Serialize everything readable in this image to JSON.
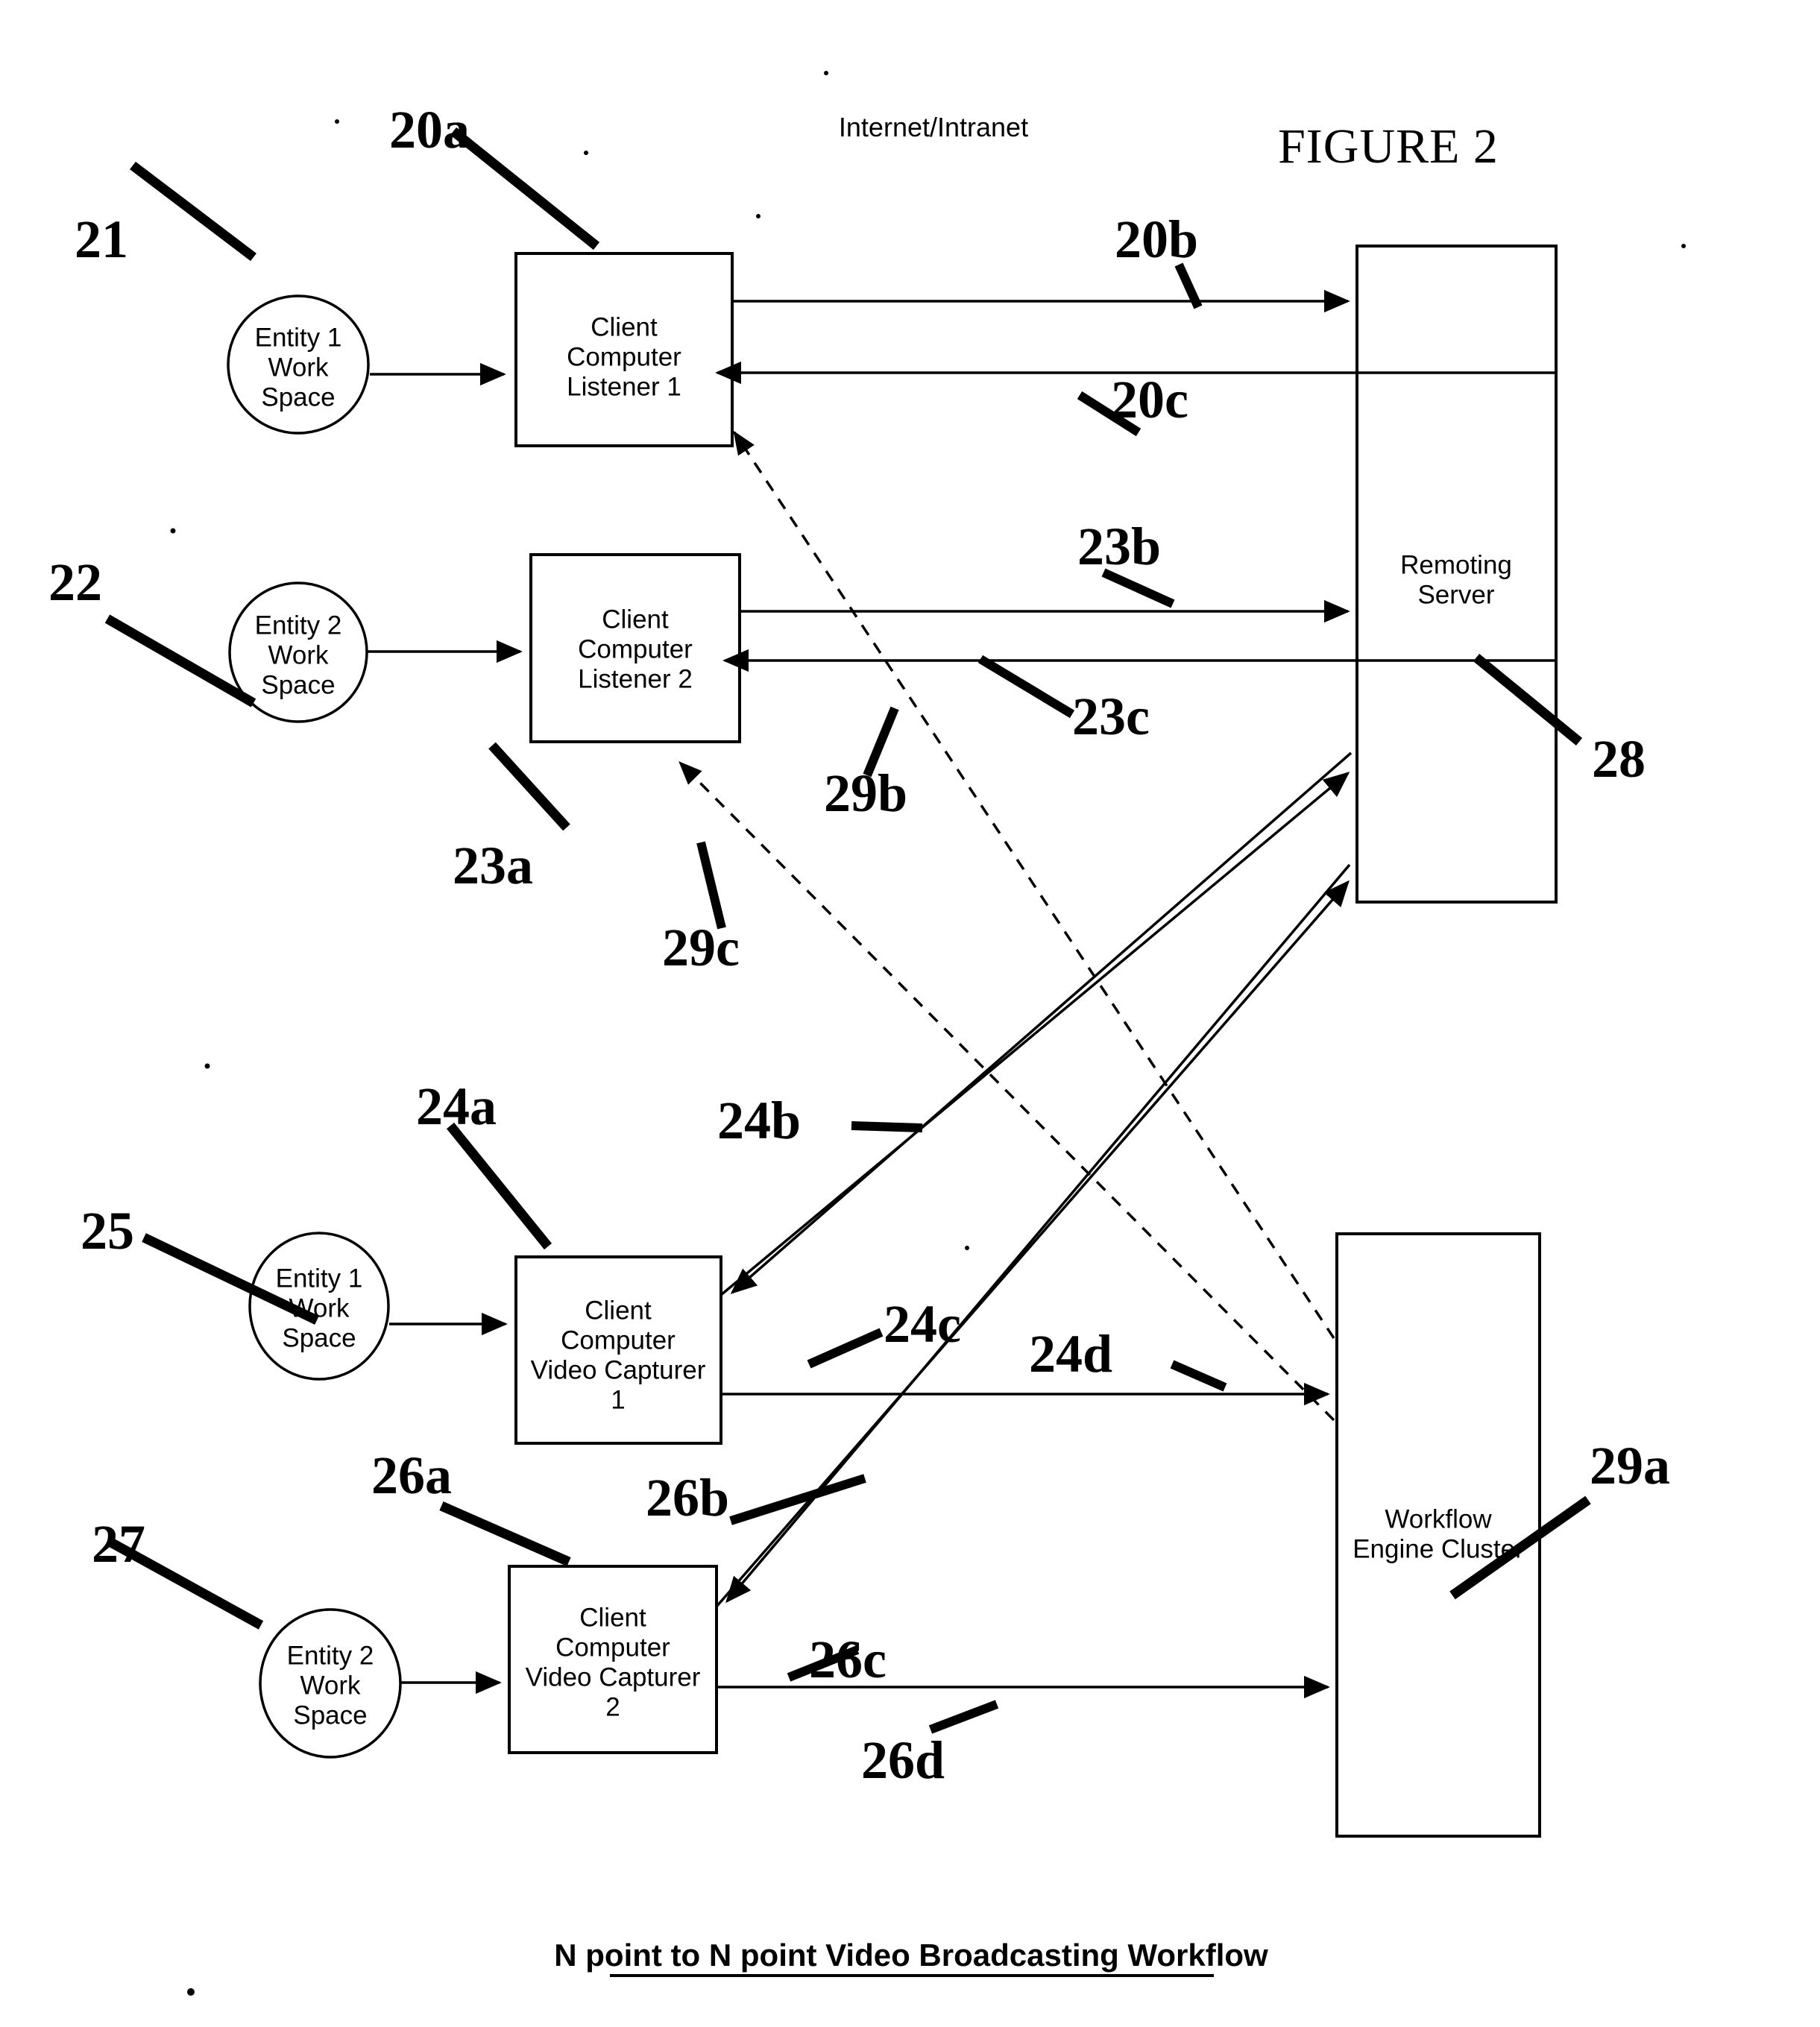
{
  "figure": {
    "title": "FIGURE 2",
    "caption": "N point to N point Video Broadcasting Workflow",
    "network_label": "Internet/Intranet"
  },
  "nodes": {
    "entity1_listener_ws": {
      "line1": "Entity 1",
      "line2": "Work",
      "line3": "Space"
    },
    "entity2_listener_ws": {
      "line1": "Entity 2",
      "line2": "Work",
      "line3": "Space"
    },
    "entity1_capturer_ws": {
      "line1": "Entity 1",
      "line2": "Work",
      "line3": "Space"
    },
    "entity2_capturer_ws": {
      "line1": "Entity 2",
      "line2": "Work",
      "line3": "Space"
    },
    "client_listener_1": {
      "line1": "Client",
      "line2": "Computer",
      "line3": "Listener 1"
    },
    "client_listener_2": {
      "line1": "Client",
      "line2": "Computer",
      "line3": "Listener 2"
    },
    "video_capturer_1": {
      "line1": "Client",
      "line2": "Computer",
      "line3": "Video Capturer",
      "line4": "1"
    },
    "video_capturer_2": {
      "line1": "Client",
      "line2": "Computer",
      "line3": "Video Capturer",
      "line4": "2"
    },
    "remoting_server": {
      "line1": "Remoting",
      "line2": "Server"
    },
    "workflow_engine": {
      "line1": "Workflow",
      "line2": "Engine Cluster"
    }
  },
  "reference_numerals": {
    "n20a": "20a",
    "n20b": "20b",
    "n20c": "20c",
    "n21": "21",
    "n22": "22",
    "n23a": "23a",
    "n23b": "23b",
    "n23c": "23c",
    "n24a": "24a",
    "n24b": "24b",
    "n24c": "24c",
    "n24d": "24d",
    "n25": "25",
    "n26a": "26a",
    "n26b": "26b",
    "n26c": "26c",
    "n26d": "26d",
    "n27": "27",
    "n28": "28",
    "n29a": "29a",
    "n29b": "29b",
    "n29c": "29c"
  },
  "colors": {
    "ink": "#000000",
    "paper": "#ffffff"
  }
}
